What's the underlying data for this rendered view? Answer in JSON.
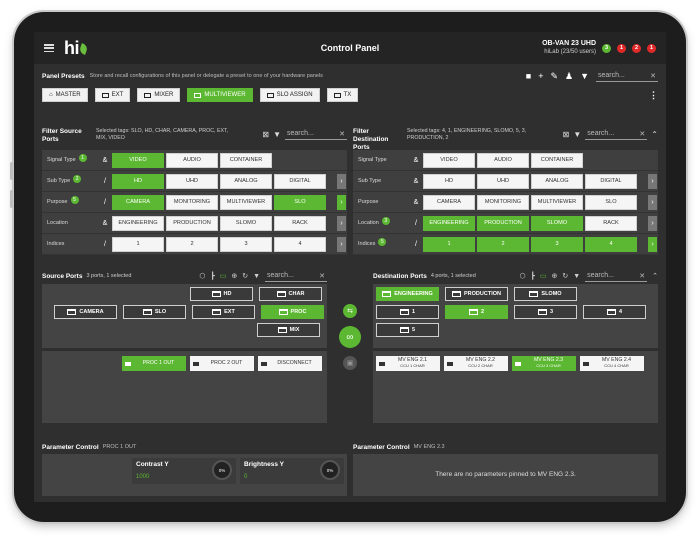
{
  "header": {
    "title": "Control Panel",
    "van_name": "OB-VAN 23 UHD",
    "van_sub": "hiLab (23/50 users)",
    "logo_text": "hi",
    "badges": [
      "3",
      "1",
      "2",
      "1"
    ]
  },
  "presets": {
    "title": "Panel Presets",
    "desc": "Store and recall configurations of this panel or delegate a preset to one of your hardware panels",
    "search_placeholder": "search...",
    "buttons": [
      {
        "label": "MASTER",
        "active": false
      },
      {
        "label": "EXT",
        "active": false
      },
      {
        "label": "MIXER",
        "active": false
      },
      {
        "label": "MULTIVIEWER",
        "active": true
      },
      {
        "label": "SLO ASSIGN",
        "active": false
      },
      {
        "label": "TX",
        "active": false
      }
    ]
  },
  "filter_source": {
    "title": "Filter Source Ports",
    "tags": "Selected tags: SLO, HD, CHAR, CAMERA, PROC, EXT, MIX, VIDEO",
    "search_placeholder": "search...",
    "rows": [
      {
        "label": "Signal Type",
        "badge": "1",
        "op": "&",
        "chips": [
          {
            "t": "VIDEO",
            "on": true
          },
          {
            "t": "AUDIO",
            "on": false
          },
          {
            "t": "CONTAINER",
            "on": false
          }
        ],
        "arrow": null
      },
      {
        "label": "Sub Type",
        "badge": "2",
        "op": "/",
        "chips": [
          {
            "t": "HD",
            "on": true
          },
          {
            "t": "UHD",
            "on": false
          },
          {
            "t": "ANALOG",
            "on": false
          },
          {
            "t": "DIGITAL",
            "on": false
          }
        ],
        "arrow": "off"
      },
      {
        "label": "Purpose",
        "badge": "5",
        "op": "/",
        "chips": [
          {
            "t": "CAMERA",
            "on": true
          },
          {
            "t": "MONITORING",
            "on": false
          },
          {
            "t": "MULTIVIEWER",
            "on": false
          },
          {
            "t": "SLO",
            "on": true
          }
        ],
        "arrow": "on"
      },
      {
        "label": "Location",
        "badge": "",
        "op": "&",
        "chips": [
          {
            "t": "ENGINEERING",
            "on": false
          },
          {
            "t": "PRODUCTION",
            "on": false
          },
          {
            "t": "SLOMO",
            "on": false
          },
          {
            "t": "RACK",
            "on": false
          }
        ],
        "arrow": "off"
      },
      {
        "label": "Indices",
        "badge": "",
        "op": "/",
        "chips": [
          {
            "t": "1",
            "on": false
          },
          {
            "t": "2",
            "on": false
          },
          {
            "t": "3",
            "on": false
          },
          {
            "t": "4",
            "on": false
          }
        ],
        "arrow": "off"
      }
    ]
  },
  "filter_dest": {
    "title": "Filter Destination Ports",
    "tags": "Selected tags: 4, 1, ENGINEERING, SLOMO, 5, 3, PRODUCTION, 2",
    "search_placeholder": "search...",
    "rows": [
      {
        "label": "Signal Type",
        "badge": "",
        "op": "&",
        "chips": [
          {
            "t": "VIDEO",
            "on": false
          },
          {
            "t": "AUDIO",
            "on": false
          },
          {
            "t": "CONTAINER",
            "on": false
          }
        ],
        "arrow": null
      },
      {
        "label": "Sub Type",
        "badge": "",
        "op": "&",
        "chips": [
          {
            "t": "HD",
            "on": false
          },
          {
            "t": "UHD",
            "on": false
          },
          {
            "t": "ANALOG",
            "on": false
          },
          {
            "t": "DIGITAL",
            "on": false
          }
        ],
        "arrow": "off"
      },
      {
        "label": "Purpose",
        "badge": "",
        "op": "&",
        "chips": [
          {
            "t": "CAMERA",
            "on": false
          },
          {
            "t": "MONITORING",
            "on": false
          },
          {
            "t": "MULTIVIEWER",
            "on": false
          },
          {
            "t": "SLO",
            "on": false
          }
        ],
        "arrow": "off"
      },
      {
        "label": "Location",
        "badge": "3",
        "op": "/",
        "chips": [
          {
            "t": "ENGINEERING",
            "on": true
          },
          {
            "t": "PRODUCTION",
            "on": true
          },
          {
            "t": "SLOMO",
            "on": true
          },
          {
            "t": "RACK",
            "on": false
          }
        ],
        "arrow": "off"
      },
      {
        "label": "Indices",
        "badge": "5",
        "op": "/",
        "chips": [
          {
            "t": "1",
            "on": true
          },
          {
            "t": "2",
            "on": true
          },
          {
            "t": "3",
            "on": true
          },
          {
            "t": "4",
            "on": true
          }
        ],
        "arrow": "on"
      }
    ]
  },
  "source_ports": {
    "title": "Source Ports",
    "sub": "3 ports, 1 selected",
    "search_placeholder": "search...",
    "row1": [
      {
        "t": "HD",
        "on": false
      },
      {
        "t": "CHAR",
        "on": false
      }
    ],
    "row2": [
      {
        "t": "CAMERA",
        "on": false
      },
      {
        "t": "SLO",
        "on": false
      },
      {
        "t": "EXT",
        "on": false
      },
      {
        "t": "PROC",
        "on": true
      }
    ],
    "row3": [
      {
        "t": "MIX",
        "on": false
      }
    ],
    "outputs": [
      {
        "t": "PROC 1 OUT",
        "s": "",
        "on": true
      },
      {
        "t": "PROC 2 OUT",
        "s": "",
        "on": false
      },
      {
        "t": "DISCONNECT",
        "s": "",
        "on": false
      }
    ]
  },
  "dest_ports": {
    "title": "Destination Ports",
    "sub": "4 ports, 1 selected",
    "search_placeholder": "search...",
    "row1": [
      {
        "t": "ENGINEERING",
        "on": true
      },
      {
        "t": "PRODUCTION",
        "on": false
      },
      {
        "t": "SLOMO",
        "on": false
      }
    ],
    "row2": [
      {
        "t": "1",
        "on": false
      },
      {
        "t": "2",
        "on": true
      },
      {
        "t": "3",
        "on": false
      },
      {
        "t": "4",
        "on": false
      }
    ],
    "row3": [
      {
        "t": "5",
        "on": false
      }
    ],
    "outputs": [
      {
        "t": "MV ENG 2.1",
        "s": "CCU 1 CHAR",
        "on": false
      },
      {
        "t": "MV ENG 2.2",
        "s": "CCU 2 CHAR",
        "on": false
      },
      {
        "t": "MV ENG 2.3",
        "s": "CCU 3 CHAR",
        "on": true
      },
      {
        "t": "MV ENG 2.4",
        "s": "CCU 4 CHAR",
        "on": false
      }
    ]
  },
  "param_src": {
    "title": "Parameter Control",
    "sub": "PROC 1 OUT",
    "knobs": [
      {
        "name": "Contrast Y",
        "value": "1000",
        "pct": "0%"
      },
      {
        "name": "Brightness Y",
        "value": "0",
        "pct": "0%"
      }
    ]
  },
  "param_dst": {
    "title": "Parameter Control",
    "sub": "MV ENG 2.3",
    "empty": "There are no parameters pinned to MV ENG 2.3."
  },
  "colors": {
    "accent": "#5cb832",
    "alert": "#e02a2a",
    "bg": "#3a3a3a"
  }
}
